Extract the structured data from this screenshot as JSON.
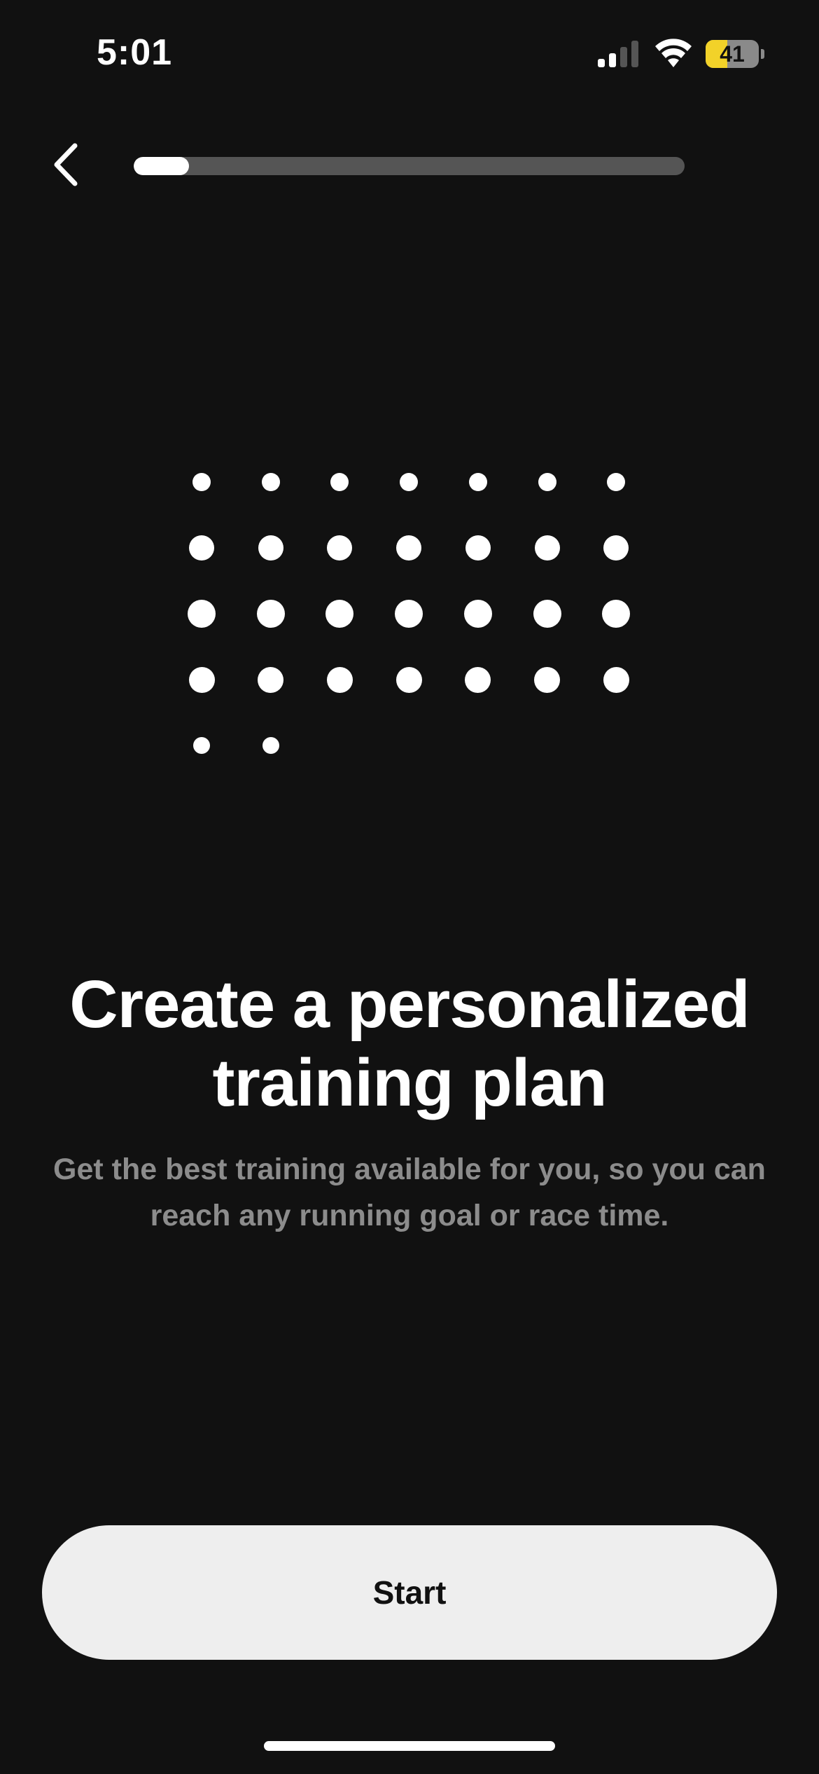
{
  "status_bar": {
    "time": "5:01",
    "signal_icon": "cellular-signal-icon",
    "signal_bars_active": 2,
    "signal_bars_total": 4,
    "wifi_icon": "wifi-icon",
    "battery_icon": "battery-icon",
    "battery_level": "41",
    "battery_fraction": 0.41,
    "battery_color": "#f2d229"
  },
  "nav": {
    "back_icon": "chevron-left-icon",
    "progress_fraction": 0.1
  },
  "illustration": {
    "icon": "dot-grid-calendar-icon",
    "columns": 7,
    "rows": [
      7,
      7,
      7,
      7,
      2
    ]
  },
  "content": {
    "title": "Create a personalized training plan",
    "subtitle": "Get the best training available for you, so you can reach any running goal or race time."
  },
  "actions": {
    "start_label": "Start"
  },
  "colors": {
    "background": "#111111",
    "text_primary": "#ffffff",
    "text_secondary": "#8c8c8c",
    "button_bg": "#eeeeee",
    "button_text": "#111111",
    "progress_track": "#555555",
    "progress_fill": "#ffffff"
  }
}
